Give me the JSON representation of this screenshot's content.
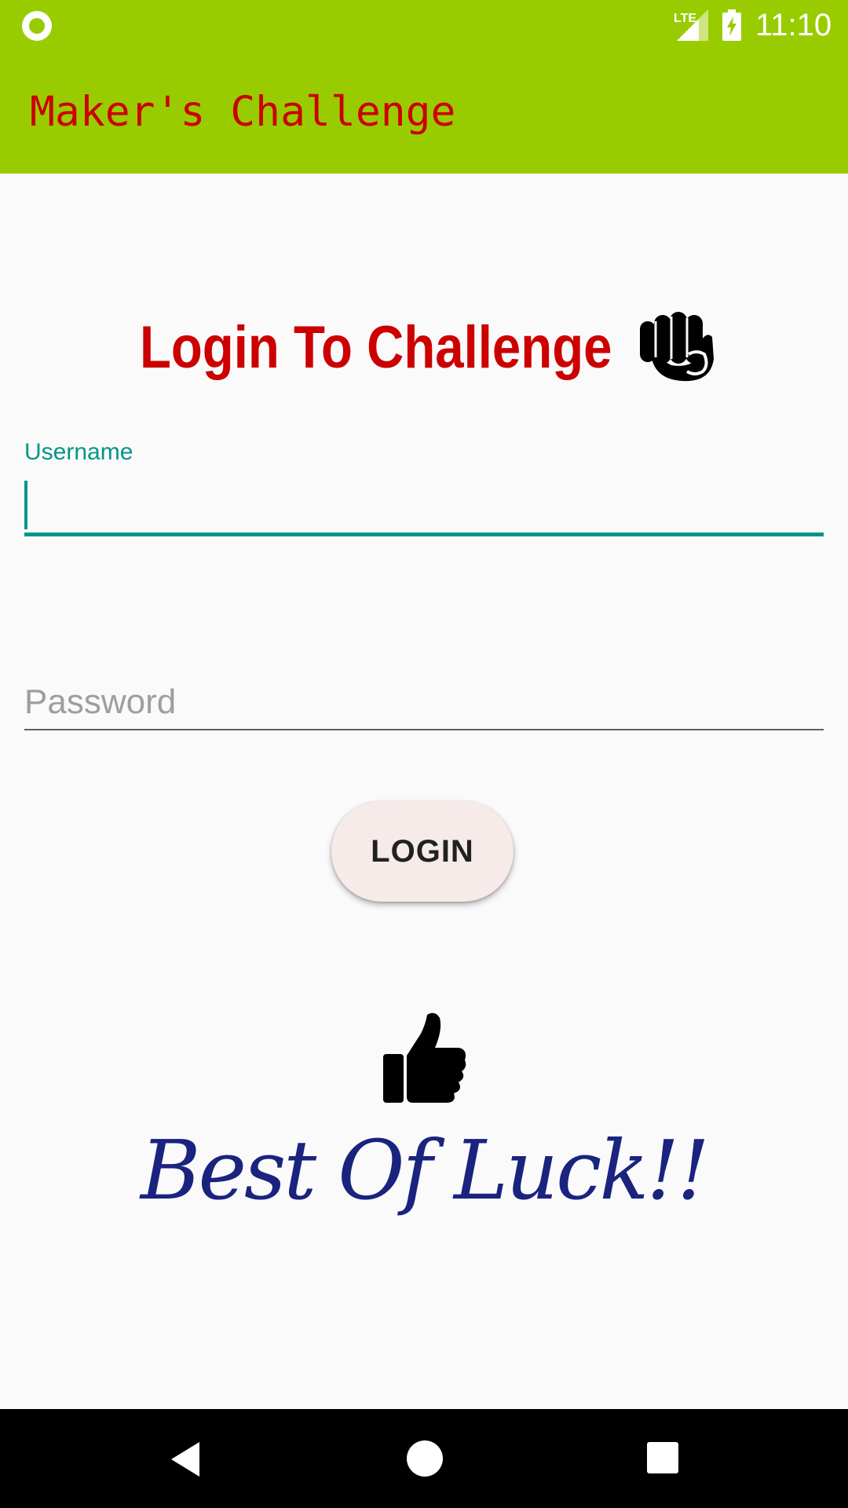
{
  "status_bar": {
    "network": "LTE",
    "time": "11:10"
  },
  "app_bar": {
    "title": "Maker's Challenge",
    "background": "#99cc00",
    "title_color": "#cc0000"
  },
  "login": {
    "heading": "Login To Challenge",
    "heading_icon": "fist-icon",
    "username": {
      "label": "Username",
      "value": "",
      "accent": "#009688"
    },
    "password": {
      "placeholder": "Password",
      "value": ""
    },
    "button_label": "LOGIN"
  },
  "footer": {
    "icon": "thumbs-up-icon",
    "tagline": "Best Of Luck!!",
    "tagline_color": "#1a237e"
  },
  "nav_bar": {
    "buttons": [
      "back-icon",
      "home-icon",
      "recents-icon"
    ]
  }
}
